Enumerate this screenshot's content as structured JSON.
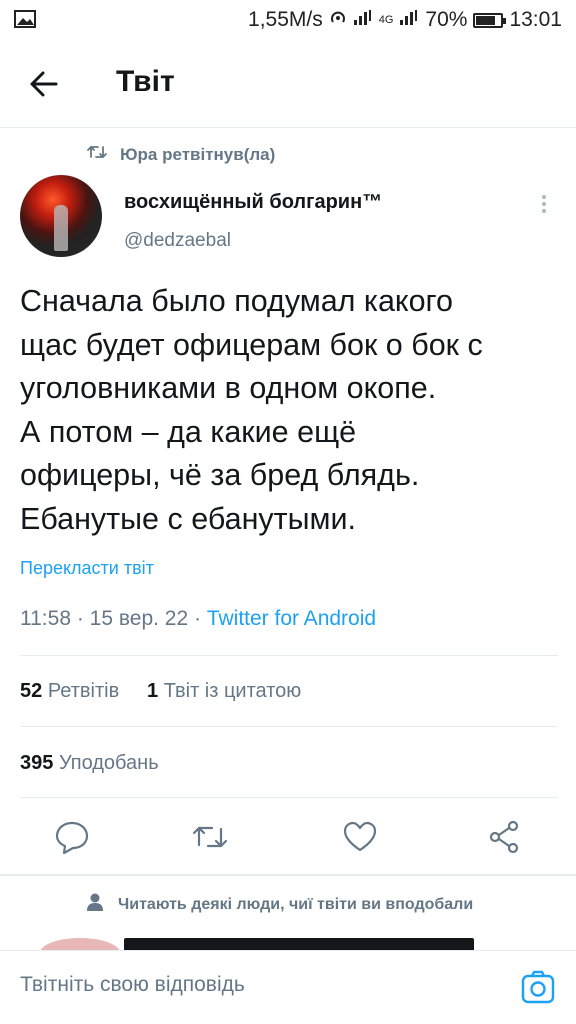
{
  "status_bar": {
    "speed": "1,55M/s",
    "network": "4G",
    "battery": "70%",
    "time": "13:01"
  },
  "header": {
    "title": "Твіт"
  },
  "retweet": {
    "text": "Юра ретвітнув(ла)"
  },
  "tweet": {
    "display_name": "восхищённый болгарин™",
    "handle": "@dedzaebal",
    "text": "Сначала было подумал какого\nщас будет офицерам бок о бок с\nуголовниками в одном окопе.\nА потом – да какие ещё\nофицеры, чё за бред блядь.\nЕбанутые с ебанутыми.",
    "translate": "Перекласти твіт",
    "timestamp": "11:58 · 15 вер. 22 · ",
    "source": "Twitter for Android"
  },
  "stats": {
    "retweets_count": "52",
    "retweets_label": "Ретвітів",
    "quotes_count": "1",
    "quotes_label": "Твіт із цитатою",
    "likes_count": "395",
    "likes_label": "Уподобань"
  },
  "suggestion": {
    "text": "Читають деякі люди, чиї твіти ви вподобали"
  },
  "reply": {
    "placeholder": "Твітніть свою відповідь"
  },
  "icons": {
    "back": "arrow-left-icon",
    "more": "vertical-dots-icon",
    "reply": "comment-icon",
    "retweet": "retweet-icon",
    "like": "heart-icon",
    "share": "share-icon",
    "camera": "camera-icon"
  },
  "colors": {
    "accent": "#1da1f2",
    "secondary_text": "#657786",
    "primary_text": "#14171a"
  }
}
